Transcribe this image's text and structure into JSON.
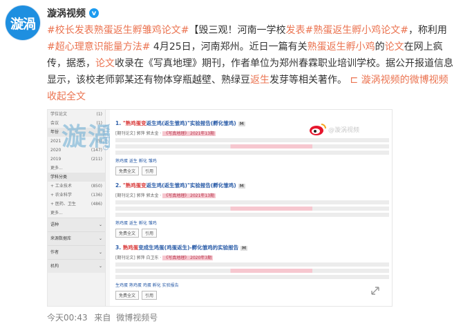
{
  "author": {
    "name": "漩涡视频",
    "avatar_text": "漩渦"
  },
  "post": {
    "tag1": "#校长发表熟蛋返生孵雏鸡论文#",
    "t1": "【毁三观！河南一学校",
    "hl1": "发表",
    "tag2": "熟蛋返生孵小鸡论文",
    "t2": "，称利用",
    "tag3": "超心理意识能量方法",
    "t3": "#",
    "t4": "4月25日，河南郑州。近日一篇有关",
    "hl2": "熟蛋返生孵小鸡",
    "t5": "的",
    "hl3": "论文",
    "t6": "在网上疯传，据悉，",
    "hl4": "论文",
    "t7": "收录在《写真地理》期刊，作者单位为郑州春霖职业培训学校。据公开报道信息显示，该校老师郭某还有物体穿瓶越壁、熟绿豆",
    "hl5": "返生",
    "t8": "发芽等相关著作。",
    "video_link": "漩涡视频的微博视频",
    "collapse": "收起全文",
    "expand_prefix": "#"
  },
  "media": {
    "watermark": "漩渦",
    "watermark2": "Video",
    "weibo_watermark": "@漩涡视频",
    "sidebar": [
      {
        "label": "学位论文",
        "count": "(1)"
      },
      {
        "label": "会议",
        "count": "(1)"
      },
      {
        "label": "年份",
        "count": "",
        "head": true
      },
      {
        "label": "2021",
        "count": "(5)"
      },
      {
        "label": "2020",
        "count": "(147)"
      },
      {
        "label": "2019",
        "count": "(211)"
      },
      {
        "label": "更多...",
        "count": ""
      },
      {
        "label": "学科分类",
        "count": "",
        "head": true
      },
      {
        "label": "+ 工业技术",
        "count": "(850)"
      },
      {
        "label": "+ 农业科学",
        "count": "(136)"
      },
      {
        "label": "+ 医药、卫生",
        "count": "(486)"
      },
      {
        "label": "更多...",
        "count": ""
      }
    ],
    "sections": [
      "语种",
      "来源数据库",
      "作者",
      "机构"
    ],
    "results": [
      {
        "num": "1.",
        "hl": "\"熟鸡蛋变",
        "title": "返生鸡(返生雏鸡)\"实验报告(孵化雏鸡)",
        "meta_a": "[期刊论文] 郭萍 郭太金 ·",
        "meta_pink": "《写真地理》",
        "meta_b": "2021年13期",
        "kw": "熟鸡蛋 返生 孵化 雏鸡",
        "btn1": "免费全文",
        "btn2": "引用"
      },
      {
        "num": "2.",
        "hl": "\"熟鸡蛋变",
        "title": "返生鸡(返生雏鸡)\"实验报告(孵化雏鸡)",
        "meta_a": "[期刊论文] 郭萍 郭太金 ·",
        "meta_pink": "《写真地理》",
        "meta_b": "2021年13期",
        "kw": "熟鸡蛋 返生 孵化 雏鸡",
        "btn1": "免费全文",
        "btn2": "引用"
      },
      {
        "num": "3.",
        "hl": "熟鸡蛋",
        "title": "变成生鸡蛋(鸡蛋返生)-孵化雏鸡的实验报告",
        "meta_a": "[期刊论文] 郭萍 白卫东 ·",
        "meta_pink": "《写真地理》",
        "meta_b": "2020年3期",
        "kw": "生鸡蛋 熟鸡蛋 鸡蛋 孵化 实验报告",
        "btn1": "免费全文",
        "btn2": "引用"
      }
    ]
  },
  "footer": {
    "time": "今天00:43",
    "source_prefix": "来自",
    "source": "微博视频号"
  }
}
